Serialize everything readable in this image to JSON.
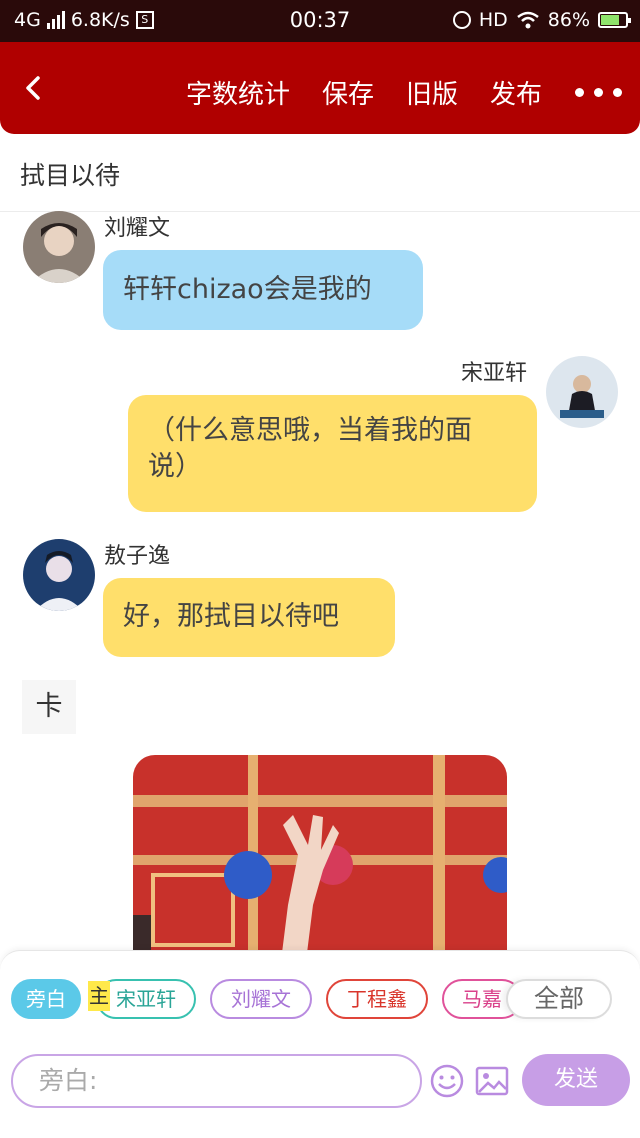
{
  "status_bar": {
    "network": "4G",
    "speed": "6.8K/s",
    "time": "00:37",
    "hd": "HD",
    "battery": "86%"
  },
  "header": {
    "actions": [
      "字数统计",
      "保存",
      "旧版",
      "发布"
    ]
  },
  "story": {
    "title": "拭目以待"
  },
  "messages": [
    {
      "name": "刘耀文",
      "text": "轩轩chizao会是我的",
      "side": "left",
      "color": "#a6dcf8"
    },
    {
      "name": "宋亚轩",
      "text": "（什么意思哦，当着我的面说）",
      "side": "right",
      "color": "#ffdf6b"
    },
    {
      "name": "敖子逸",
      "text": "好，那拭目以待吧",
      "side": "left",
      "color": "#ffdf6b"
    }
  ],
  "card": {
    "label": "卡"
  },
  "composer": {
    "chips": [
      "旁白",
      "宋亚轩",
      "刘耀文",
      "丁程鑫",
      "马嘉",
      "全部"
    ],
    "main_badge": "主",
    "input_placeholder": "旁白:",
    "send_label": "发送"
  }
}
